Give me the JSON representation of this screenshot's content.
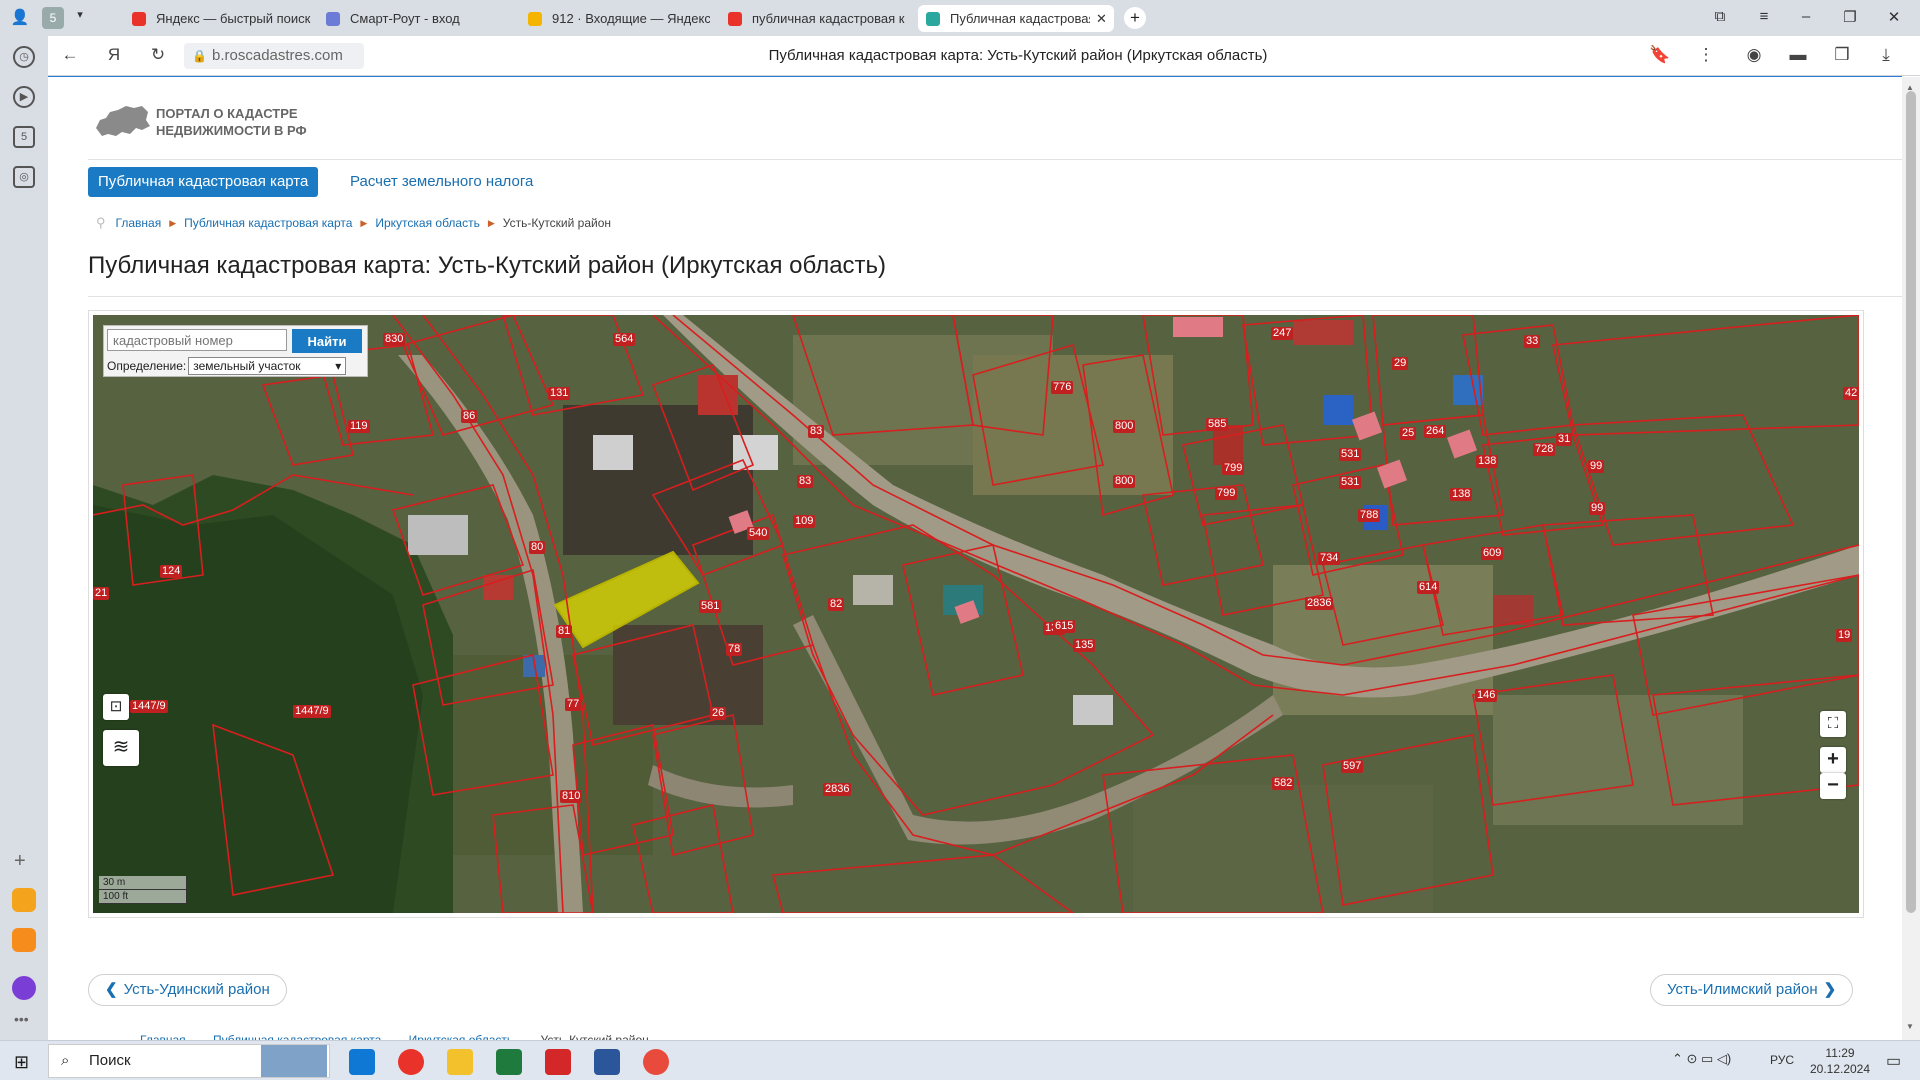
{
  "browser": {
    "tab_count": "5",
    "tabs": [
      {
        "title": "Яндекс — быстрый поиск",
        "favicon_color": "#e8322a"
      },
      {
        "title": "Смарт-Роут - вход",
        "favicon_color": "#6b7bd6"
      },
      {
        "title": "912 · Входящие — Яндекс",
        "favicon_color": "#f5b400"
      },
      {
        "title": "публичная кадастровая к",
        "favicon_color": "#e8322a"
      },
      {
        "title": "Публичная кадастровая к",
        "favicon_color": "#2aa8a0"
      }
    ],
    "url": "b.roscadastres.com",
    "page_title": "Публичная кадастровая карта: Усть-Кутский район (Иркутская область)"
  },
  "site": {
    "portal_line1": "ПОРТАЛ О КАДАСТРЕ",
    "portal_line2": "НЕДВИЖИМОСТИ В РФ",
    "nav": [
      {
        "label": "Публичная кадастровая карта",
        "active": true
      },
      {
        "label": "Расчет земельного налога",
        "active": false
      }
    ],
    "breadcrumbs": [
      "Главная",
      "Публичная кадастровая карта",
      "Иркутская область",
      "Усть-Кутский район"
    ],
    "heading": "Публичная кадастровая карта: Усть-Кутский район (Иркутская область)",
    "prev_link": "Усть-Удинский район",
    "next_link": "Усть-Илимский район"
  },
  "map": {
    "search_placeholder": "кадастровый номер",
    "search_button": "Найти",
    "definition_label": "Определение:",
    "definition_value": "земельный участок",
    "scale_m": "30 m",
    "scale_ft": "100 ft",
    "zoom_in": "+",
    "zoom_out": "−",
    "parcel_labels": [
      "830",
      "564",
      "131",
      "119",
      "86",
      "776",
      "800",
      "585",
      "247",
      "29",
      "33",
      "42",
      "83",
      "83",
      "109",
      "540",
      "80",
      "581",
      "82",
      "78",
      "81",
      "26",
      "77",
      "1447/9",
      "1447/9",
      "21",
      "124",
      "810",
      "2836",
      "2836",
      "135",
      "615",
      "135",
      "800",
      "799",
      "799",
      "531",
      "531",
      "788",
      "25",
      "264",
      "138",
      "138",
      "728",
      "31",
      "99",
      "99",
      "609",
      "614",
      "734",
      "19",
      "146",
      "597",
      "582"
    ]
  },
  "taskbar": {
    "search_label": "Поиск",
    "lang": "РУС",
    "time": "11:29",
    "date": "20.12.2024"
  }
}
